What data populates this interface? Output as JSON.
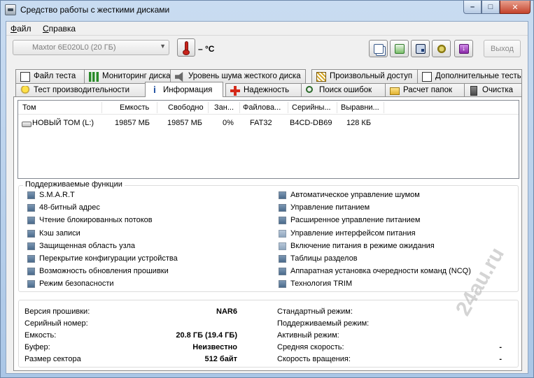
{
  "window": {
    "title": "Средство работы с жесткими дисками",
    "controls": {
      "minimize": "–",
      "maximize": "□",
      "close": "✕"
    }
  },
  "menu": [
    "Файл",
    "Справка"
  ],
  "toolbar": {
    "drive": "Maxtor 6E020L0   (20 ГБ)",
    "temperature": "– °C",
    "exit_label": "Выход",
    "buttons": [
      "copy-icon",
      "report-icon",
      "save-icon",
      "settings-icon",
      "download-icon"
    ]
  },
  "tabs_top": [
    "Файл теста",
    "Мониторинг диска",
    "Уровень шума жесткого диска",
    "Произвольный доступ",
    "Дополнительные тесты"
  ],
  "tabs_bottom": [
    "Тест производительности",
    "Информация",
    "Надежность",
    "Поиск ошибок",
    "Расчет папок",
    "Очистка"
  ],
  "active_tab": "Информация",
  "volumes": {
    "columns": [
      "Том",
      "Емкость",
      "Свободно",
      "Зан...",
      "Файлова...",
      "Серийны...",
      "Выравни..."
    ],
    "rows": [
      {
        "name": "НОВЫЙ ТОМ (L:)",
        "capacity": "19857 МБ",
        "free": "19857 МБ",
        "used": "0%",
        "fs": "FAT32",
        "serial": "B4CD-DB69",
        "align": "128 КБ"
      }
    ]
  },
  "features": {
    "title": "Поддерживаемые функции",
    "left": [
      "S.M.A.R.T",
      "48-битный адрес",
      "Чтение блокированных потоков",
      "Кэш записи",
      "Защищенная область узла",
      "Перекрытие конфигурации устройства",
      "Возможность обновления прошивки",
      "Режим безопасности"
    ],
    "right": [
      "Автоматическое управление шумом",
      "Управление питанием",
      "Расширенное управление питанием",
      "Управление интерфейсом питания",
      "Включение питания в режиме ожидания",
      "Таблицы разделов",
      "Аппаратная установка очередности команд (NCQ)",
      "Технология TRIM"
    ],
    "right_light": [
      false,
      false,
      false,
      true,
      true,
      false,
      false,
      false
    ]
  },
  "details": {
    "left": [
      {
        "label": "Версия прошивки:",
        "value": "NAR6"
      },
      {
        "label": "Серийный номер:",
        "value": ""
      },
      {
        "label": "Емкость:",
        "value": "20.8 ГБ (19.4 ГБ)"
      },
      {
        "label": "Буфер:",
        "value": "Неизвестно"
      },
      {
        "label": "Размер сектора",
        "value": "512 байт"
      }
    ],
    "right": [
      {
        "label": "Стандартный режим:",
        "value": ""
      },
      {
        "label": "Поддерживаемый режим:",
        "value": ""
      },
      {
        "label": "Активный режим:",
        "value": ""
      },
      {
        "label": "Средняя скорость:",
        "value": "-"
      },
      {
        "label": "Скорость вращения:",
        "value": "-"
      }
    ]
  },
  "watermark": "24au.ru",
  "colors": {
    "accent": "#3c6fb0",
    "titlebar": "#c9dcf1",
    "checkbox": "#4a6b8c"
  }
}
